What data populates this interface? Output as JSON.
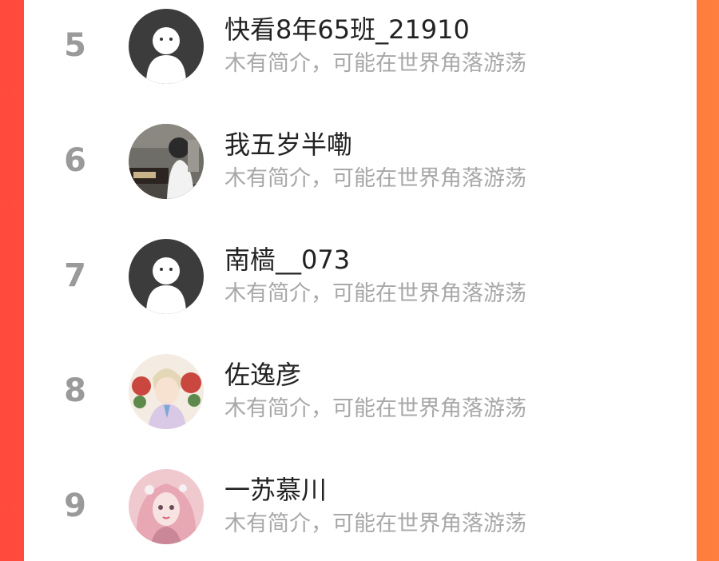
{
  "leaderboard": {
    "rows": [
      {
        "rank": "5",
        "name": "快看8年65班_21910",
        "bio": "木有简介，可能在世界角落游荡",
        "avatar": "default-avatar-icon"
      },
      {
        "rank": "6",
        "name": "我五岁半嘞",
        "bio": "木有简介，可能在世界角落游荡",
        "avatar": "photo-avatar"
      },
      {
        "rank": "7",
        "name": "南樯__073",
        "bio": "木有简介，可能在世界角落游荡",
        "avatar": "default-avatar-icon"
      },
      {
        "rank": "8",
        "name": "佐逸彦",
        "bio": "木有简介，可能在世界角落游荡",
        "avatar": "anime-avatar"
      },
      {
        "rank": "9",
        "name": "一苏慕川",
        "bio": "木有简介，可能在世界角落游荡",
        "avatar": "anime-avatar-pink"
      }
    ]
  },
  "colors": {
    "background_left": "#ff4a3d",
    "background_right": "#ff7f3d",
    "rank": "#9a9a9a",
    "name": "#222222",
    "bio": "#a8a8a8"
  }
}
